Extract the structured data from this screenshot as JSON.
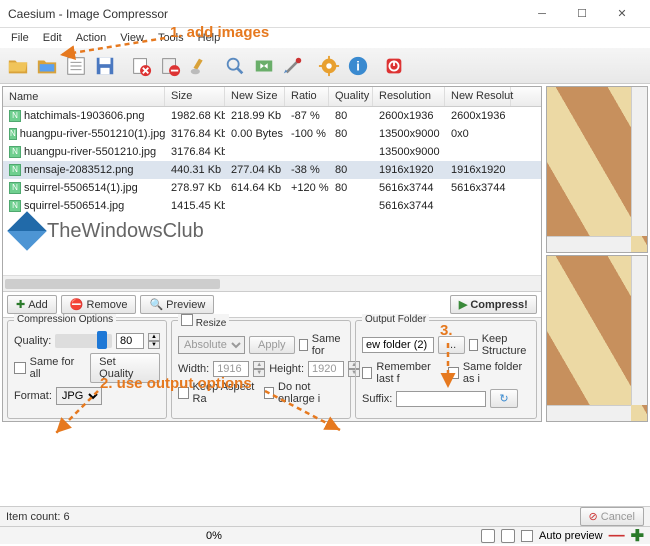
{
  "window": {
    "title": "Caesium - Image Compressor"
  },
  "menu": {
    "file": "File",
    "edit": "Edit",
    "action": "Action",
    "view": "View",
    "tools": "Tools",
    "help": "Help"
  },
  "columns": {
    "name": "Name",
    "size": "Size",
    "newsize": "New Size",
    "ratio": "Ratio",
    "quality": "Quality",
    "resolution": "Resolution",
    "newres": "New Resolut"
  },
  "rows": [
    {
      "name": "hatchimals-1903606.png",
      "size": "1982.68 Kb",
      "newsize": "218.99 Kb",
      "ratio": "-87 %",
      "quality": "80",
      "res": "2600x1936",
      "newres": "2600x1936"
    },
    {
      "name": "huangpu-river-5501210(1).jpg",
      "size": "3176.84 Kb",
      "newsize": "0.00 Bytes",
      "ratio": "-100 %",
      "quality": "80",
      "res": "13500x9000",
      "newres": "0x0"
    },
    {
      "name": "huangpu-river-5501210.jpg",
      "size": "3176.84 Kb",
      "newsize": "",
      "ratio": "",
      "quality": "",
      "res": "13500x9000",
      "newres": ""
    },
    {
      "name": "mensaje-2083512.png",
      "size": "440.31 Kb",
      "newsize": "277.04 Kb",
      "ratio": "-38 %",
      "quality": "80",
      "res": "1916x1920",
      "newres": "1916x1920"
    },
    {
      "name": "squirrel-5506514(1).jpg",
      "size": "278.97 Kb",
      "newsize": "614.64 Kb",
      "ratio": "+120 %",
      "quality": "80",
      "res": "5616x3744",
      "newres": "5616x3744"
    },
    {
      "name": "squirrel-5506514.jpg",
      "size": "1415.45 Kb",
      "newsize": "",
      "ratio": "",
      "quality": "",
      "res": "5616x3744",
      "newres": ""
    }
  ],
  "watermark": "TheWindowsClub",
  "buttons": {
    "add": "Add",
    "remove": "Remove",
    "preview": "Preview",
    "compress": "Compress!",
    "cancel": "Cancel",
    "setquality": "Set Quality",
    "apply": "Apply"
  },
  "compression": {
    "legend": "Compression Options",
    "quality_label": "Quality:",
    "quality_value": "80",
    "sameforall": "Same for all",
    "format_label": "Format:",
    "format_value": "JPG"
  },
  "resize": {
    "legend": "Resize",
    "absolute": "Absolute",
    "samefor": "Same for",
    "width_label": "Width:",
    "width_value": "1916",
    "height_label": "Height:",
    "height_value": "1920",
    "keepaspect": "Keep Aspect Ra",
    "noenlarge": "Do not enlarge i"
  },
  "output": {
    "legend": "Output Folder",
    "path_value": "ew folder (2)",
    "keepstructure": "Keep Structure",
    "remember": "Remember last f",
    "sameas": "Same folder as i",
    "suffix_label": "Suffix:",
    "suffix_value": ""
  },
  "status": {
    "itemcount": "Item count: 6",
    "zoom": "0%"
  },
  "bottom": {
    "autopreview": "Auto preview"
  },
  "annotations": {
    "a1": "1. add images",
    "a2": "2. use output options",
    "a3": "3."
  }
}
